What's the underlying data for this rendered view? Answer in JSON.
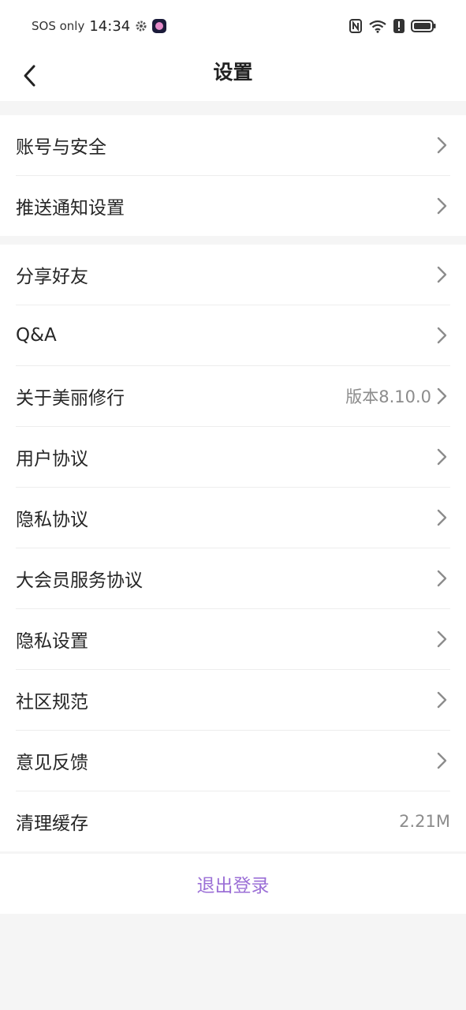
{
  "status_bar": {
    "carrier": "SOS only",
    "time": "14:34",
    "icons": [
      "gear-icon",
      "app-notification-icon",
      "nfc-icon",
      "wifi-icon",
      "alert-icon",
      "battery-icon"
    ]
  },
  "header": {
    "title": "设置",
    "back_icon": "chevron-left-icon"
  },
  "groups": {
    "account": {
      "items": [
        {
          "label": "账号与安全"
        },
        {
          "label": "推送通知设置"
        }
      ]
    },
    "general": {
      "items": [
        {
          "label": "分享好友"
        },
        {
          "label": "Q&A"
        },
        {
          "label": "关于美丽修行",
          "value": "版本8.10.0"
        },
        {
          "label": "用户协议"
        },
        {
          "label": "隐私协议"
        },
        {
          "label": "大会员服务协议"
        },
        {
          "label": "隐私设置"
        },
        {
          "label": "社区规范"
        },
        {
          "label": "意见反馈"
        },
        {
          "label": "清理缓存",
          "value": "2.21M"
        }
      ]
    }
  },
  "logout": {
    "label": "退出登录"
  },
  "colors": {
    "accent": "#9b6fd6",
    "background": "#f5f5f5",
    "card": "#ffffff",
    "muted_text": "#8c8c8c"
  }
}
